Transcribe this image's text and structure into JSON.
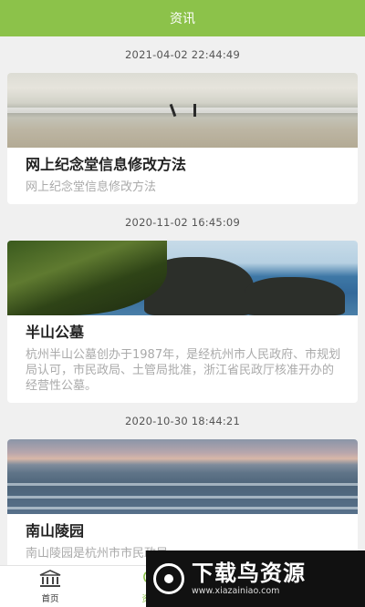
{
  "header": {
    "title": "资讯"
  },
  "feed": [
    {
      "timestamp": "2021-04-02 22:44:49",
      "title": "网上纪念堂信息修改方法",
      "desc": "网上纪念堂信息修改方法"
    },
    {
      "timestamp": "2020-11-02 16:45:09",
      "title": "半山公墓",
      "desc": "杭州半山公墓创办于1987年，是经杭州市人民政府、市规划局认可，市民政局、土管局批准，浙江省民政厅核准开办的经营性公墓。"
    },
    {
      "timestamp": "2020-10-30 18:44:21",
      "title": "南山陵园",
      "desc": "南山陵园是杭州市市民政局、"
    }
  ],
  "tabbar": {
    "tabs": [
      {
        "label": "首页",
        "icon": "bank-icon",
        "active": false
      },
      {
        "label": "资讯",
        "icon": "broadcast-icon",
        "active": true
      }
    ]
  },
  "watermark": {
    "title": "下载鸟资源",
    "url": "www.xiazainiao.com"
  },
  "colors": {
    "accent": "#8cc24a",
    "background": "#f0f0f0"
  }
}
